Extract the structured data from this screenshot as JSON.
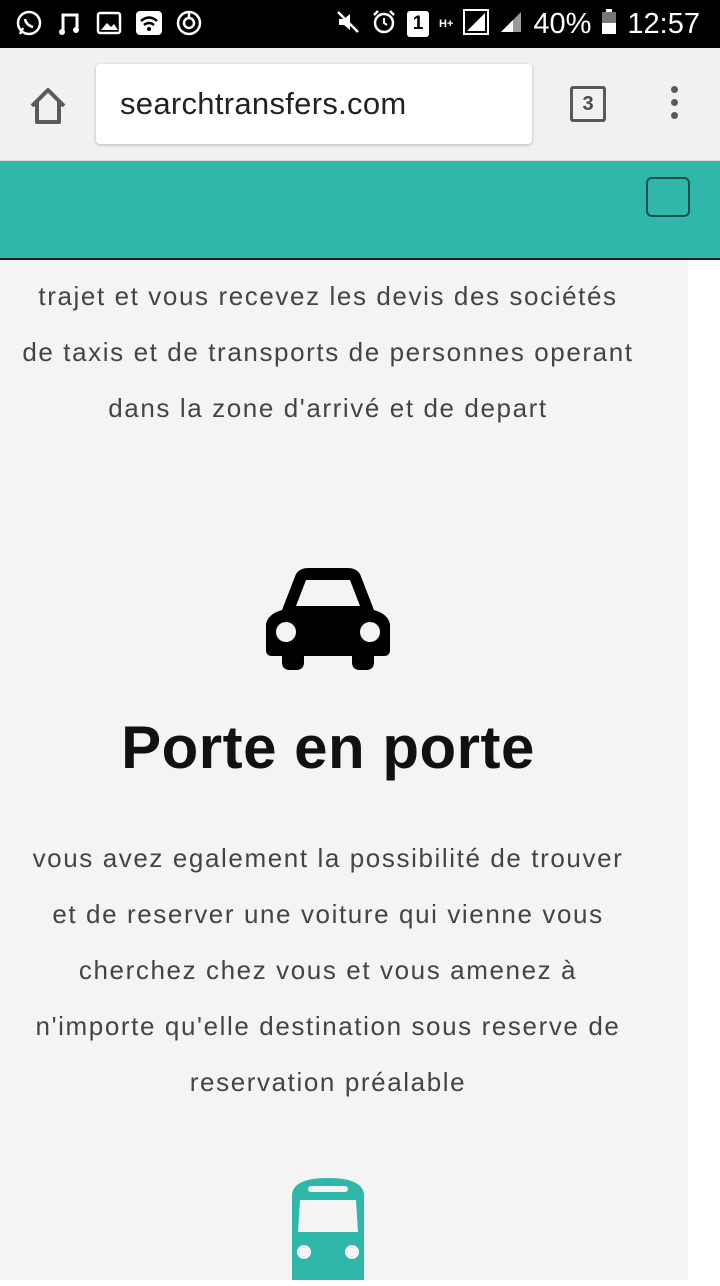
{
  "status_bar": {
    "battery_percent": "40%",
    "time": "12:57",
    "sim_slot": "1",
    "network_type": "H+",
    "left_icons": [
      "whatsapp-icon",
      "music-icon",
      "gallery-icon",
      "wifi-icon",
      "sync-icon"
    ],
    "right_icons": [
      "mute-icon",
      "alarm-icon",
      "sim-icon",
      "signal-icon",
      "battery-icon"
    ]
  },
  "browser": {
    "url": "searchtransfers.com",
    "tab_count": "3"
  },
  "site": {
    "accent_color": "#2fb7aa"
  },
  "content": {
    "intro_text": "trajet et vous recevez les devis des sociétés de taxis et de transports de personnes operant dans la zone d'arrivé et de depart",
    "section_title": "Porte en porte",
    "section_text": "vous avez egalement la possibilité de trouver et de reserver une voiture qui vienne vous cherchez chez vous et vous amenez à n'importe qu'elle destination sous reserve de reservation préalable",
    "icons": [
      "car-icon",
      "bus-icon"
    ]
  }
}
